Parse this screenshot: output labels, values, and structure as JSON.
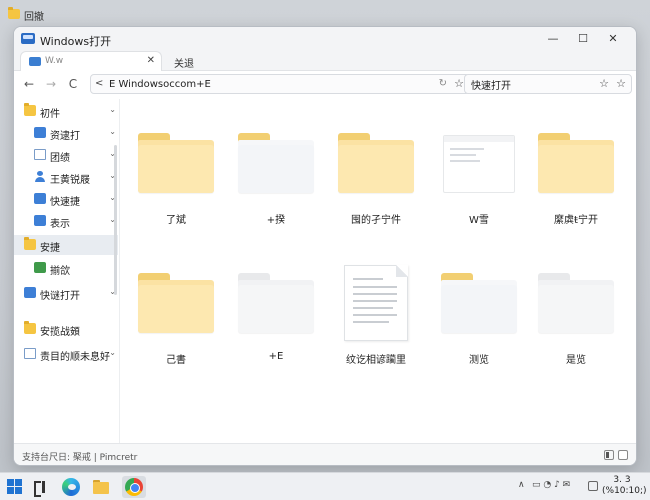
{
  "desktop": {
    "top_label": "回撤"
  },
  "window": {
    "title": "Windows打开",
    "controls": {
      "minimize": "—",
      "maximize": "☐",
      "close": "✕"
    },
    "tabs": [
      {
        "label": "W.w",
        "close": "✕"
      },
      {
        "label": "关退"
      }
    ]
  },
  "nav": {
    "back": "←",
    "forward": "→",
    "refresh": "C",
    "address_chevron": "<",
    "address_path": "E  Windowsoccom+E",
    "search_value": "快速打开"
  },
  "sidebar": {
    "items": [
      {
        "label": "初件",
        "icon": "folder-icon"
      },
      {
        "label": "资逮打",
        "icon": "blue-app-icon"
      },
      {
        "label": "团绩",
        "icon": "document-icon"
      },
      {
        "label": "王黄锐屐",
        "icon": "user-icon"
      },
      {
        "label": "快速捷",
        "icon": "blue-app-icon"
      },
      {
        "label": "表示",
        "icon": "blue-app-icon"
      },
      {
        "label": "安捷",
        "icon": "folder-icon"
      },
      {
        "label": "揃欱",
        "icon": "green-app-icon"
      },
      {
        "label": "快谜打开",
        "icon": "blue-app-icon"
      },
      {
        "label": "安揽战頞",
        "icon": "folder-icon"
      },
      {
        "label": "责目的顺未息好",
        "icon": "document-icon"
      }
    ]
  },
  "content": {
    "items": [
      {
        "label": "了斌",
        "type": "folder"
      },
      {
        "label": "+揆",
        "type": "folder-pale-tab"
      },
      {
        "label": "囤的孑宁件",
        "type": "folder"
      },
      {
        "label": "W雪",
        "type": "window-doc"
      },
      {
        "label": "縻虡ŧ宁开",
        "type": "folder"
      },
      {
        "label": "己書",
        "type": "folder"
      },
      {
        "label": "+E",
        "type": "folder-pale"
      },
      {
        "label": "纹讫相谚躏里",
        "type": "text-document"
      },
      {
        "label": "测览",
        "type": "folder-mixed"
      },
      {
        "label": "是览",
        "type": "folder-pale"
      }
    ]
  },
  "statusbar": {
    "text": "支持台尺日:  棸戒  |  Pimcretr"
  },
  "taskbar": {
    "tray_arrow": "∧",
    "tray_icons": "▭ ◔ ♪ ✉",
    "clock_line1": "3. 3",
    "clock_line2": "(%10:10;)"
  },
  "colors": {
    "folder_yellow": "#fde8b0",
    "accent_blue": "#2b6cc4",
    "active_sidebar": "#e8ecf1"
  }
}
